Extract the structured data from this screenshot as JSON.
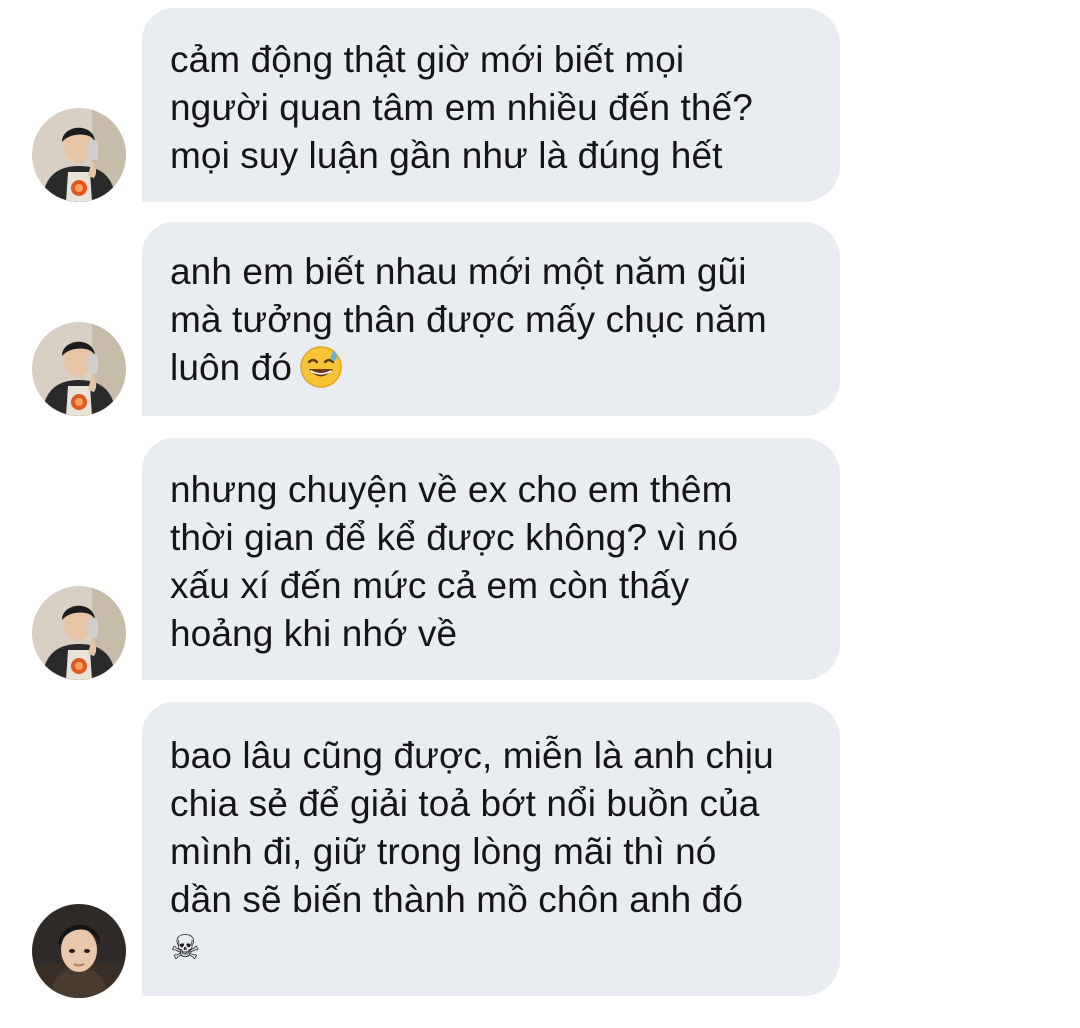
{
  "messages": [
    {
      "text": "cảm động thật giờ mới biết mọi\nngười quan tâm em nhiều đến thế?\nmọi suy luận gần như là đúng hết",
      "avatar": "friend-avatar-icon"
    },
    {
      "text": "anh em biết nhau mới một năm gũi\nmà tưởng thân được mấy chục năm\nluôn đó",
      "emoji": "sweat-smile-emoji",
      "avatar": "friend-avatar-icon"
    },
    {
      "text": "nhưng chuyện về ex cho em thêm\nthời gian để kể được không? vì nó\nxấu xí đến mức cả em còn thấy\nhoảng khi nhớ về",
      "avatar": "friend-avatar-icon"
    },
    {
      "text": "bao lâu cũng được, miễn là anh chịu\nchia sẻ để giải toả bớt nổi buồn của\nmình đi, giữ trong lòng mãi thì nó\ndần sẽ biến thành mồ chôn anh đó",
      "emoji_text": "☠",
      "avatar": "user-avatar-icon"
    }
  ],
  "colors": {
    "bubble": "#e9edf2",
    "text": "#151515",
    "background": "#ffffff"
  }
}
